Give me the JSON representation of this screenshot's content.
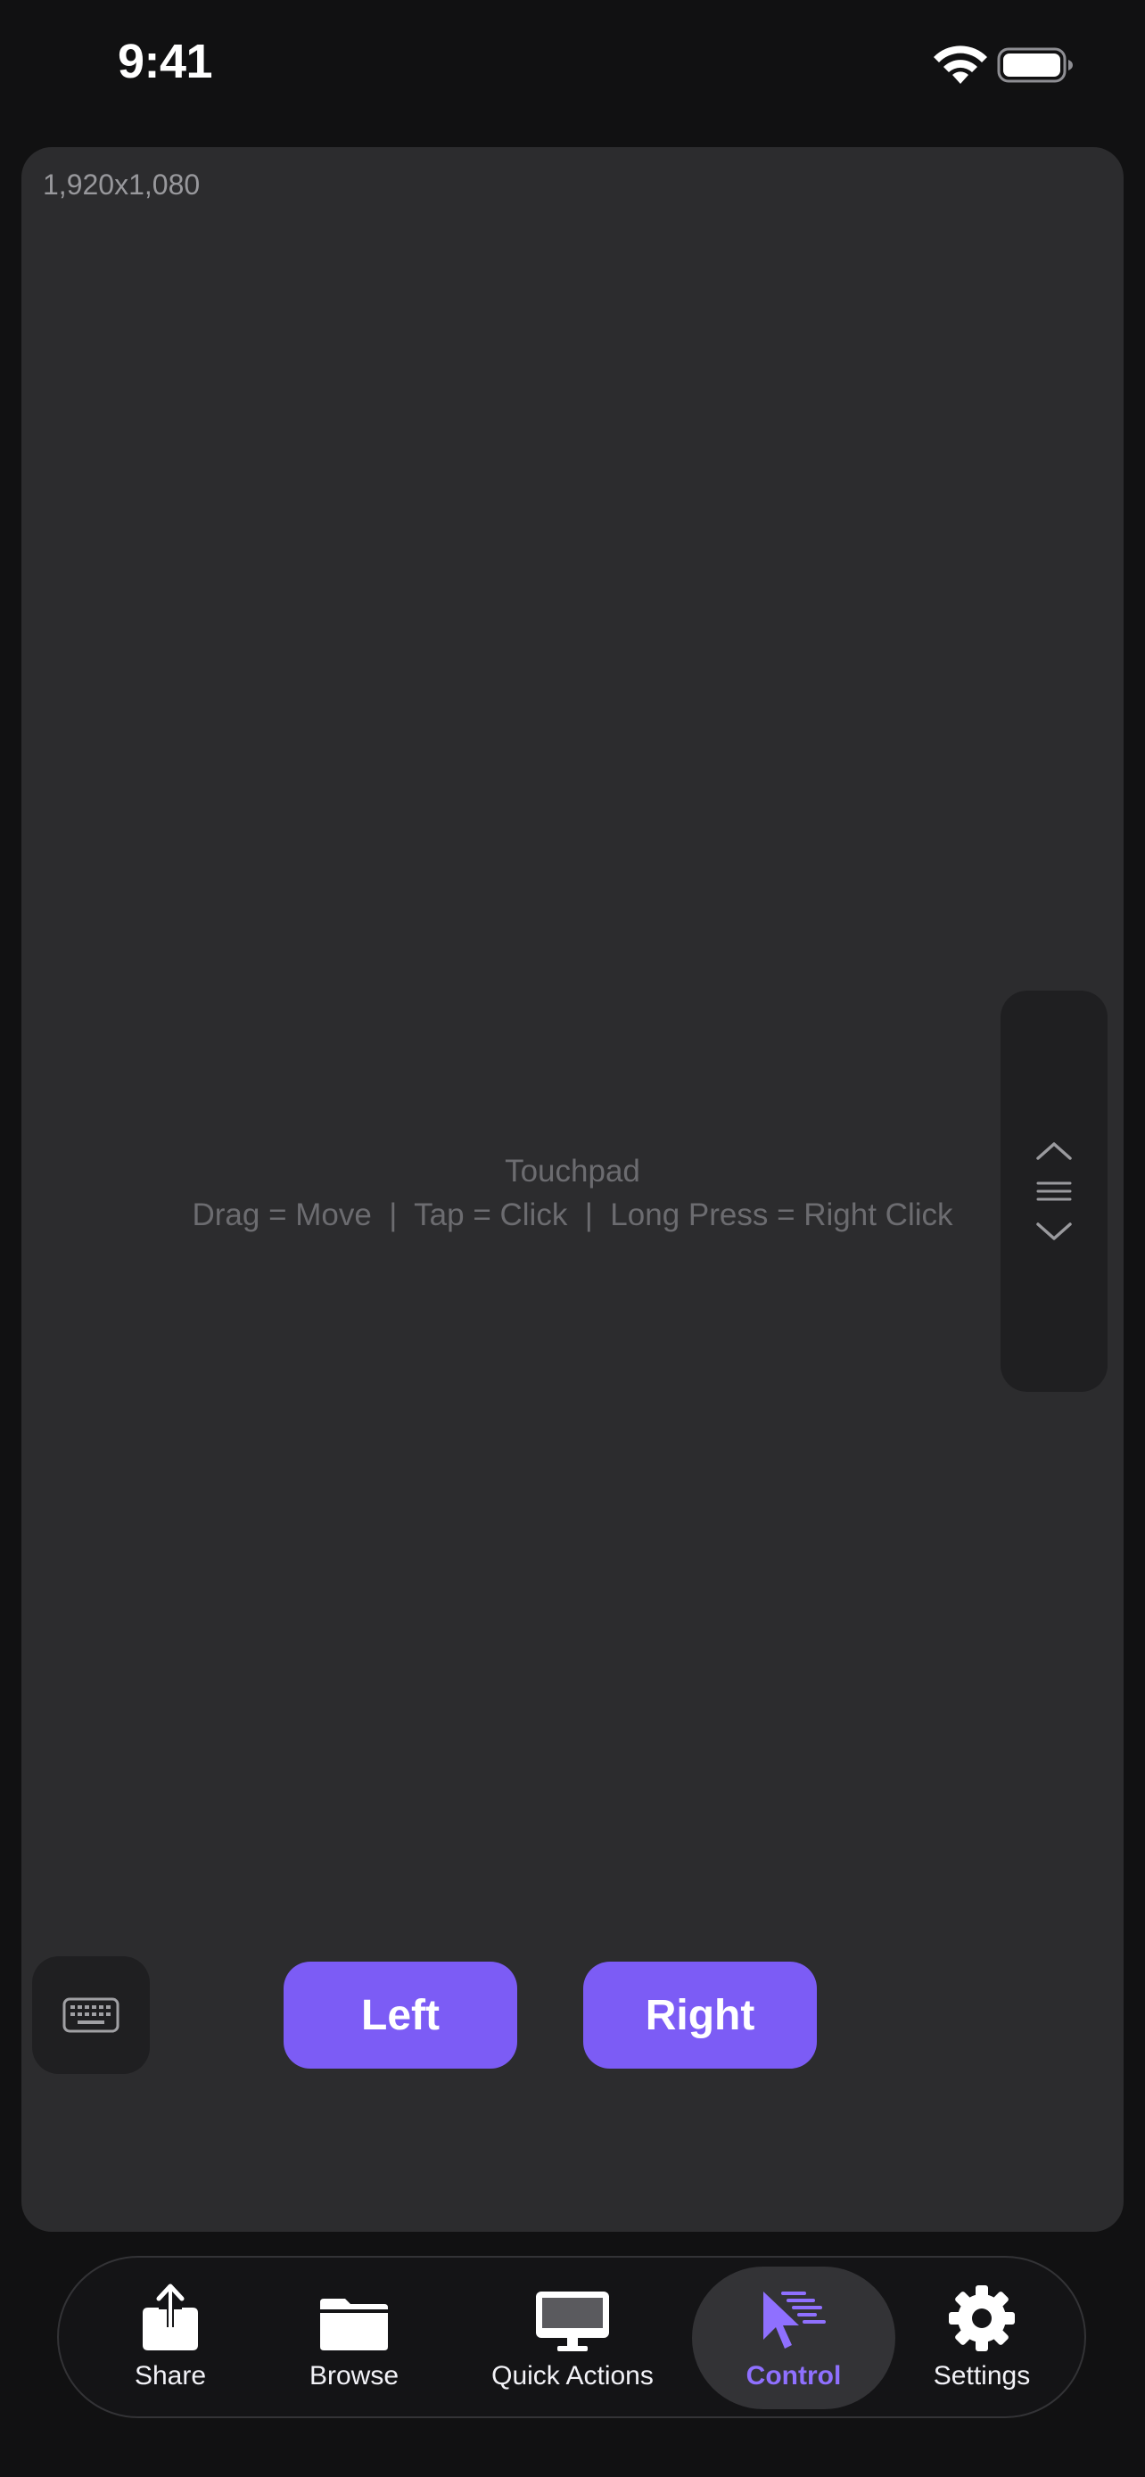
{
  "status_bar": {
    "time": "9:41"
  },
  "touchpad": {
    "resolution": "1,920x1,080",
    "hint_title": "Touchpad",
    "hint_gestures": "Drag = Move  |  Tap = Click  |  Long Press = Right Click"
  },
  "buttons": {
    "left_label": "Left",
    "right_label": "Right"
  },
  "tabs": [
    {
      "label": "Share",
      "icon": "share-icon"
    },
    {
      "label": "Browse",
      "icon": "folder-icon"
    },
    {
      "label": "Quick Actions",
      "icon": "desktop-icon"
    },
    {
      "label": "Control",
      "icon": "cursor-icon",
      "active": true
    },
    {
      "label": "Settings",
      "icon": "gear-icon"
    }
  ],
  "colors": {
    "accent": "#7C5CF5",
    "background": "#111112",
    "panel": "#2C2C2E"
  }
}
